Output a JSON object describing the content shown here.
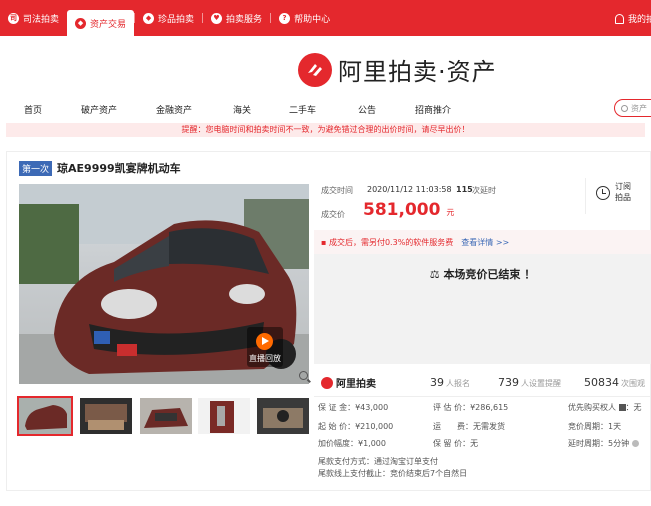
{
  "topnav": {
    "items": [
      {
        "label": "司法拍卖",
        "icon": "gavel-icon",
        "glyph": "司"
      },
      {
        "label": "资产交易",
        "icon": "ali-logo-icon",
        "glyph": "◆",
        "active": true
      },
      {
        "label": "珍品拍卖",
        "icon": "ali-logo-icon",
        "glyph": "◆"
      },
      {
        "label": "拍卖服务",
        "icon": "heart-icon",
        "glyph": "♥"
      },
      {
        "label": "帮助中心",
        "icon": "help-icon",
        "glyph": "?"
      }
    ],
    "my_auction": "我的拍"
  },
  "brand": {
    "name": "阿里拍卖·资产",
    "color": "#e4282d"
  },
  "mainnav": {
    "items": [
      "首页",
      "破产资产",
      "金融资产",
      "海关",
      "二手车",
      "公告",
      "招商推介"
    ],
    "search_placeholder": "资产"
  },
  "notice": "提醒：您电脑时间和拍卖时间不一致，为避免错过合理的出价时间，请尽早出价！",
  "lot": {
    "round_badge": "第一次",
    "title": "琼AE9999凯宴牌机动车",
    "live_replay": "直播回放"
  },
  "result": {
    "deal_time_label": "成交时间",
    "deal_time": "2020/11/12 11:03:58",
    "delays_count": "115",
    "delays_label": "次延时",
    "price_label": "成交价",
    "price": "581,000",
    "price_unit": "元",
    "subscribe_line1": "订阅",
    "subscribe_line2": "拍品",
    "fee_text": "成交后，需另付0.3%的软件服务费",
    "fee_link": "查看详情 >>",
    "ended_text": "本场竞价已结束 ！"
  },
  "stats": {
    "logo": "阿里拍卖",
    "signups": "39",
    "signups_label": "人报名",
    "reminders": "739",
    "reminders_label": "人设置提醒",
    "views": "50834",
    "views_label": "次围观"
  },
  "details": {
    "deposit": "保 证 金：¥43,000",
    "assessed": "评 估 价：¥286,615",
    "priority": "优先购买权人",
    "priority_value": "无",
    "start": "起 始 价：¥210,000",
    "transport": "运　　费：无需发货",
    "cycle": "竞价周期：1天",
    "increment": "加价幅度：¥1,000",
    "reserve": "保 留 价：无",
    "delay": "延时周期：5分钟",
    "pay_method": "尾款支付方式：通过淘宝订单支付",
    "pay_deadline": "尾款线上支付截止：竞价结束后7个自然日"
  },
  "colors": {
    "accent": "#e4282d",
    "badge": "#3d6ab6"
  }
}
